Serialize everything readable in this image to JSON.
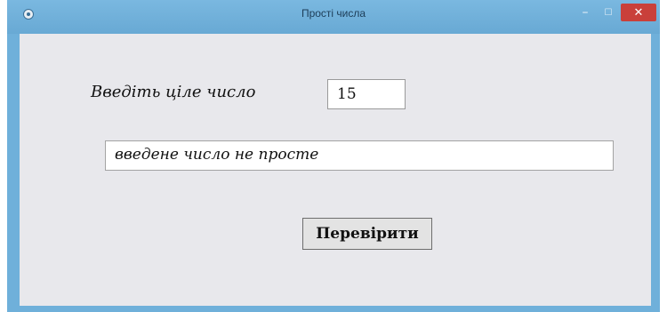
{
  "window": {
    "title": "Прості числа",
    "controls": {
      "minimize_icon": "–",
      "maximize_icon": "☐",
      "close_icon": "✕"
    }
  },
  "form": {
    "prompt_label": "Введіть ціле число",
    "number_value": "15",
    "result_text": "введене число не просте",
    "check_button_label": "Перевірити"
  },
  "colors": {
    "titlebar": "#6fb0da",
    "close_button": "#c9403a",
    "client_background": "#e8e8ec"
  },
  "icons": {
    "app": "app-icon",
    "minimize": "minimize-icon",
    "maximize": "maximize-icon",
    "close": "close-icon"
  }
}
